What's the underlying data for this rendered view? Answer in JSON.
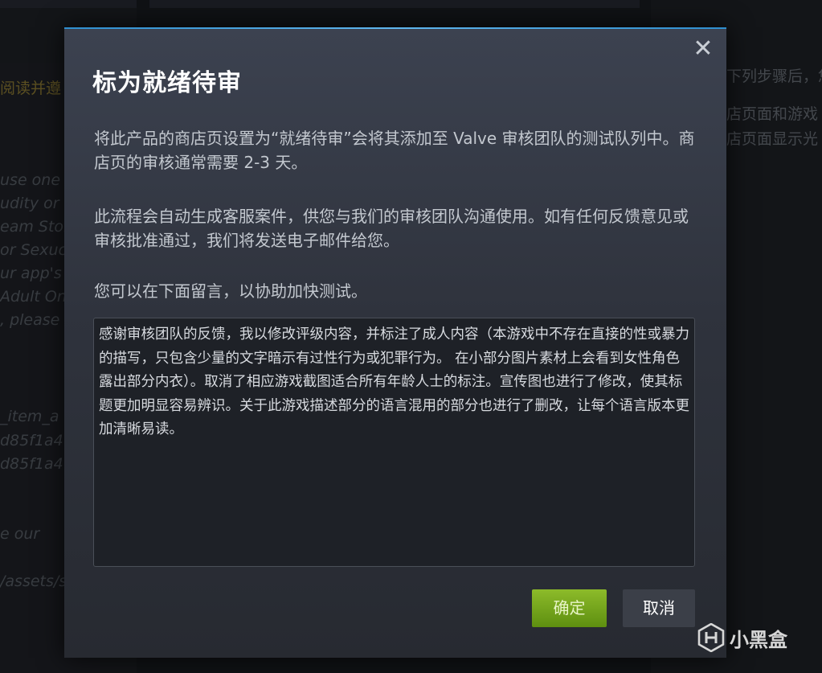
{
  "background": {
    "left_gold": "阅读并遵",
    "left_lines": [
      "use one o",
      "udity or",
      "eam Stor",
      "or Sexuc",
      "ur app's",
      "Adult On",
      ", please"
    ],
    "left_lines2": [
      "_item_a",
      "d85f1a4",
      "d85f1a4"
    ],
    "left_lines3": [
      "e our",
      "/assets/s"
    ],
    "right_lines": [
      "下列步骤后，您",
      "店页面和游戏",
      "店页面显示光"
    ]
  },
  "modal": {
    "title": "标为就绪待审",
    "close_symbol": "✕",
    "paragraph1": "将此产品的商店页设置为“就绪待审”会将其添加至 Valve 审核团队的测试队列中。商店页的审核通常需要 2-3 天。",
    "paragraph2": "此流程会自动生成客服案件，供您与我们的审核团队沟通使用。如有任何反馈意见或审核批准通过，我们将发送电子邮件给您。",
    "paragraph3": "您可以在下面留言，以协助加快测试。",
    "comment_value": "感谢审核团队的反馈，我以修改评级内容，并标注了成人内容（本游戏中不存在直接的性或暴力的描写，只包含少量的文字暗示有过性行为或犯罪行为。 在小部分图片素材上会看到女性角色露出部分内衣）。取消了相应游戏截图适合所有年龄人士的标注。宣传图也进行了修改，使其标题更加明显容易辨识。关于此游戏描述部分的语言混用的部分也进行了删改，让每个语言版本更加清晰易读。",
    "confirm_label": "确定",
    "cancel_label": "取消"
  },
  "watermark": {
    "text": "小黑盒"
  },
  "colors": {
    "accent_line": "#5fb6ee",
    "confirm_green": "#76a51d"
  }
}
